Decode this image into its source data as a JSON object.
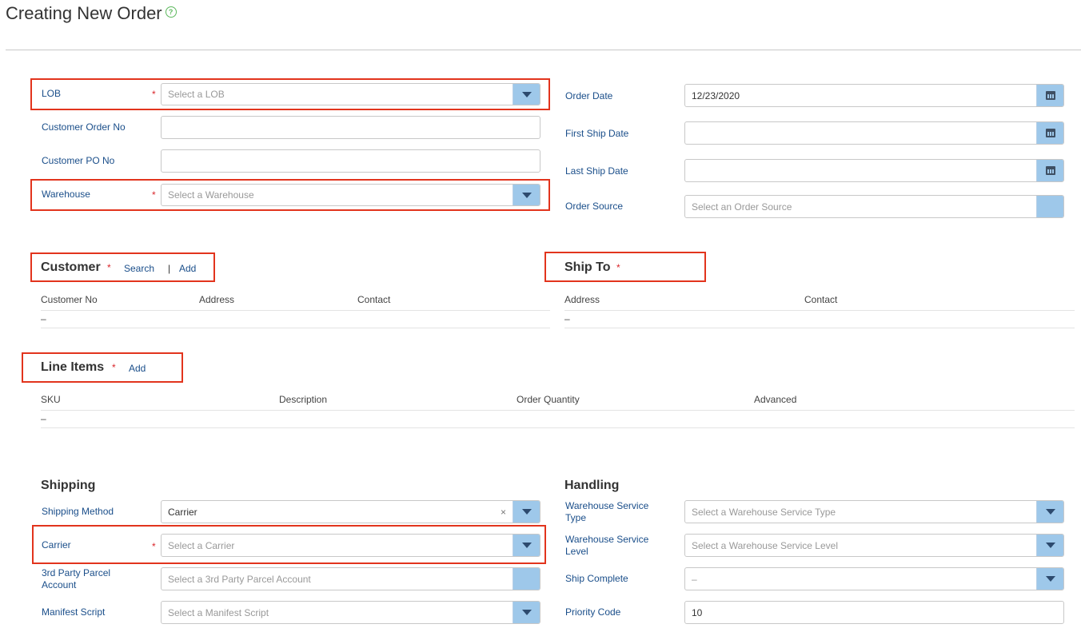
{
  "page": {
    "title": "Creating New Order"
  },
  "order_top": {
    "lob": {
      "label": "LOB",
      "placeholder": "Select a LOB"
    },
    "customer_order_no": {
      "label": "Customer Order No",
      "value": ""
    },
    "customer_po_no": {
      "label": "Customer PO No",
      "value": ""
    },
    "warehouse": {
      "label": "Warehouse",
      "placeholder": "Select a Warehouse"
    },
    "order_date": {
      "label": "Order Date",
      "value": "12/23/2020"
    },
    "first_ship_date": {
      "label": "First Ship Date",
      "value": ""
    },
    "last_ship_date": {
      "label": "Last Ship Date",
      "value": ""
    },
    "order_source": {
      "label": "Order Source",
      "placeholder": "Select an Order Source"
    }
  },
  "required_mark": "*",
  "customer": {
    "title": "Customer",
    "search_label": "Search",
    "separator": "|",
    "add_label": "Add",
    "columns": [
      "Customer No",
      "Address",
      "Contact"
    ],
    "empty": "–"
  },
  "ship_to": {
    "title": "Ship To",
    "columns": [
      "Address",
      "Contact"
    ],
    "empty": "–"
  },
  "line_items": {
    "title": "Line Items",
    "add_label": "Add",
    "columns": [
      "SKU",
      "Description",
      "Order Quantity",
      "Advanced"
    ],
    "empty": "–"
  },
  "shipping": {
    "title": "Shipping",
    "shipping_method": {
      "label": "Shipping Method",
      "value": "Carrier",
      "clear": "×"
    },
    "carrier": {
      "label": "Carrier",
      "placeholder": "Select a Carrier"
    },
    "third_party": {
      "label_line1": "3rd Party Parcel",
      "label_line2": "Account",
      "placeholder": "Select a 3rd Party Parcel Account"
    },
    "manifest_script": {
      "label": "Manifest Script",
      "placeholder": "Select a Manifest Script"
    }
  },
  "handling": {
    "title": "Handling",
    "service_type": {
      "label_line1": "Warehouse Service",
      "label_line2": "Type",
      "placeholder": "Select a Warehouse Service Type"
    },
    "service_level": {
      "label_line1": "Warehouse Service",
      "label_line2": "Level",
      "placeholder": "Select a Warehouse Service Level"
    },
    "ship_complete": {
      "label": "Ship Complete",
      "value": "–"
    },
    "priority_code": {
      "label": "Priority Code",
      "value": "10"
    }
  },
  "colors": {
    "accent_red": "#e2341d",
    "link_blue": "#1a4e8a",
    "dropdown_blue": "#9ec8ea",
    "required_red": "#d9262b"
  }
}
